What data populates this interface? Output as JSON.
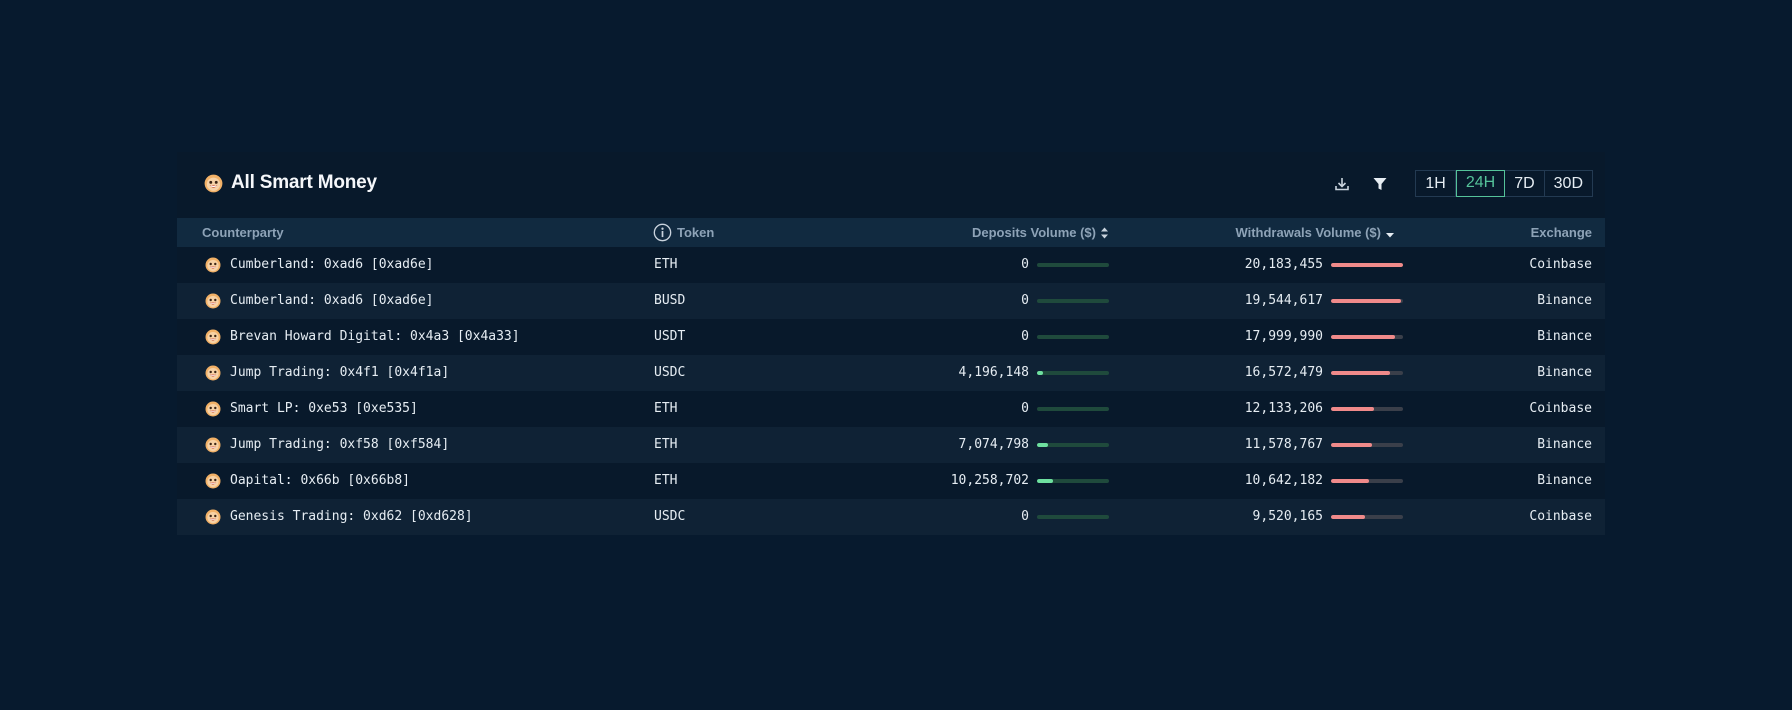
{
  "colors": {
    "page_background": "#071a2e",
    "panel_background": "#08192b",
    "header_row_background": "#112a40",
    "accent_green": "#55c39a",
    "deposit_bar_fill": "#6ee0a0",
    "deposit_bar_track": "#1f4a3c",
    "withdrawal_bar_fill": "#f08a8a",
    "withdrawal_bar_track": "#3a3f4a"
  },
  "panel": {
    "title": "All Smart Money",
    "title_icon": "smiley-face-icon"
  },
  "toolbar": {
    "download_icon": "download-icon",
    "filter_icon": "filter-icon",
    "ranges": [
      "1H",
      "24H",
      "7D",
      "30D"
    ],
    "active_range": "24H"
  },
  "table": {
    "columns": {
      "counterparty": "Counterparty",
      "token": "Token",
      "deposits": "Deposits Volume ($)",
      "withdrawals": "Withdrawals Volume ($)",
      "exchange": "Exchange"
    },
    "sort": {
      "deposits": "sortable",
      "withdrawals": "descending"
    },
    "rows": [
      {
        "counterparty": "Cumberland: 0xad6 [0xad6e]",
        "token": "ETH",
        "deposits": "0",
        "deposits_fraction": 0,
        "withdrawals": "20,183,455",
        "withdrawals_fraction": 1.0,
        "exchange": "Coinbase"
      },
      {
        "counterparty": "Cumberland: 0xad6 [0xad6e]",
        "token": "BUSD",
        "deposits": "0",
        "deposits_fraction": 0,
        "withdrawals": "19,544,617",
        "withdrawals_fraction": 0.968,
        "exchange": "Binance"
      },
      {
        "counterparty": "Brevan Howard Digital: 0x4a3 [0x4a33]",
        "token": "USDT",
        "deposits": "0",
        "deposits_fraction": 0,
        "withdrawals": "17,999,990",
        "withdrawals_fraction": 0.892,
        "exchange": "Binance"
      },
      {
        "counterparty": "Jump Trading: 0x4f1 [0x4f1a]",
        "token": "USDC",
        "deposits": "4,196,148",
        "deposits_fraction": 0.08,
        "withdrawals": "16,572,479",
        "withdrawals_fraction": 0.821,
        "exchange": "Binance"
      },
      {
        "counterparty": "Smart LP: 0xe53 [0xe535]",
        "token": "ETH",
        "deposits": "0",
        "deposits_fraction": 0,
        "withdrawals": "12,133,206",
        "withdrawals_fraction": 0.601,
        "exchange": "Coinbase"
      },
      {
        "counterparty": "Jump Trading: 0xf58 [0xf584]",
        "token": "ETH",
        "deposits": "7,074,798",
        "deposits_fraction": 0.15,
        "withdrawals": "11,578,767",
        "withdrawals_fraction": 0.574,
        "exchange": "Binance"
      },
      {
        "counterparty": "Oapital: 0x66b [0x66b8]",
        "token": "ETH",
        "deposits": "10,258,702",
        "deposits_fraction": 0.22,
        "withdrawals": "10,642,182",
        "withdrawals_fraction": 0.527,
        "exchange": "Binance"
      },
      {
        "counterparty": "Genesis Trading: 0xd62 [0xd628]",
        "token": "USDC",
        "deposits": "0",
        "deposits_fraction": 0,
        "withdrawals": "9,520,165",
        "withdrawals_fraction": 0.472,
        "exchange": "Coinbase"
      }
    ]
  }
}
